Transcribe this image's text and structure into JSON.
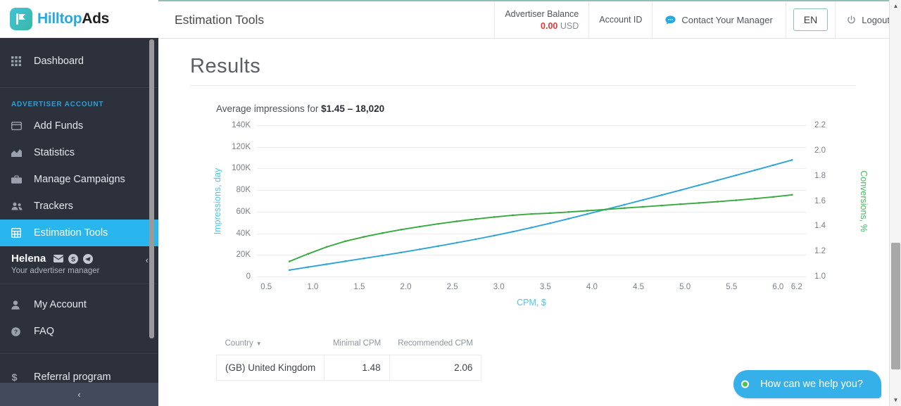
{
  "brand": {
    "name_part1": "Hilltop",
    "name_part2": "Ads",
    "logo_icon": "flag-logo-icon",
    "accent_blue": "#29a8df",
    "accent_teal": "#3ab8a8"
  },
  "sidebar": {
    "dashboard": {
      "label": "Dashboard",
      "icon": "grid-icon"
    },
    "group_label": "ADVERTISER ACCOUNT",
    "items": [
      {
        "label": "Add Funds",
        "icon": "credit-card-icon",
        "active": false
      },
      {
        "label": "Statistics",
        "icon": "chart-area-icon",
        "active": false
      },
      {
        "label": "Manage Campaigns",
        "icon": "briefcase-icon",
        "active": false
      },
      {
        "label": "Trackers",
        "icon": "users-icon",
        "active": false
      },
      {
        "label": "Estimation Tools",
        "icon": "calculator-icon",
        "active": true
      }
    ],
    "manager": {
      "name": "Helena",
      "subtitle": "Your advertiser manager",
      "icons": [
        "envelope-icon",
        "skype-icon",
        "telegram-icon"
      ],
      "collapse_icon": "chevron-left-icon"
    },
    "account_items": [
      {
        "label": "My Account",
        "icon": "user-icon"
      },
      {
        "label": "FAQ",
        "icon": "question-circle-icon"
      }
    ],
    "referral": {
      "label": "Referral program",
      "icon": "dollar-icon"
    },
    "collapse_bar_icon": "chevron-left-icon",
    "active_color": "#29b6ef"
  },
  "header": {
    "title": "Estimation Tools",
    "balance": {
      "label": "Advertiser Balance",
      "amount": "0.00",
      "currency": "USD",
      "amount_color": "#e03b3b"
    },
    "account_id": {
      "label": "Account ID"
    },
    "contact": {
      "label": "Contact Your Manager",
      "icon": "chat-bubble-icon"
    },
    "language": {
      "label": "EN"
    },
    "logout": {
      "label": "Logout",
      "icon": "power-icon"
    }
  },
  "main": {
    "page_heading": "Results",
    "chart_caption_prefix": "Average impressions for ",
    "chart_caption_value": "$1.45 – 18,020",
    "table": {
      "columns": [
        "Country",
        "Minimal CPM",
        "Recommended CPM"
      ],
      "sort_column": "Country",
      "sort_icon": "caret-down-icon",
      "rows": [
        {
          "country": "(GB) United Kingdom",
          "minimal_cpm": "1.48",
          "recommended_cpm": "2.06"
        }
      ]
    }
  },
  "chat_widget": {
    "label": "How can we help you?",
    "status_icon": "online-dot-icon",
    "bg_color": "#35b0e8"
  },
  "scrollbar": {
    "up_icon": "triangle-up-icon",
    "down_icon": "triangle-down-icon"
  },
  "chart_data": {
    "type": "line",
    "title": "",
    "xlabel": "CPM, $",
    "ylabel": "Impressions, day",
    "y2label": "Conversions, %",
    "xlim": [
      0.4,
      6.3
    ],
    "ylim": [
      0,
      140000
    ],
    "y2lim": [
      1.0,
      2.2
    ],
    "grid": true,
    "legend": "none",
    "x_ticks": [
      "0.5",
      "1.0",
      "1.5",
      "2.0",
      "2.5",
      "3.0",
      "3.5",
      "4.0",
      "4.5",
      "5.0",
      "5.5",
      "6.0",
      "6.2"
    ],
    "x_tick_values": [
      0.5,
      1.0,
      1.5,
      2.0,
      2.5,
      3.0,
      3.5,
      4.0,
      4.5,
      5.0,
      5.5,
      6.0,
      6.2
    ],
    "y_ticks": [
      "0",
      "20K",
      "40K",
      "60K",
      "80K",
      "100K",
      "120K",
      "140K"
    ],
    "y_tick_values": [
      0,
      20000,
      40000,
      60000,
      80000,
      100000,
      120000,
      140000
    ],
    "y2_ticks": [
      "1.0",
      "1.2",
      "1.4",
      "1.6",
      "1.8",
      "2.0",
      "2.2"
    ],
    "y2_tick_values": [
      1.0,
      1.2,
      1.4,
      1.6,
      1.8,
      2.0,
      2.2
    ],
    "series": [
      {
        "name": "Impressions, day",
        "color": "#2fa3d7",
        "axis": "left",
        "x": [
          0.75,
          0.95,
          1.15,
          1.35,
          1.55,
          1.75,
          1.95,
          2.15,
          2.35,
          2.55,
          2.75,
          2.95,
          3.15,
          3.35,
          3.55,
          3.75,
          3.95,
          4.15,
          4.35,
          4.55,
          4.75,
          4.95,
          5.15,
          5.35,
          5.55,
          5.75,
          5.95,
          6.15
        ],
        "y": [
          6000,
          8700,
          11400,
          14100,
          16800,
          19500,
          22300,
          25200,
          28200,
          31300,
          34500,
          37900,
          41500,
          45300,
          49300,
          53500,
          57800,
          62100,
          66500,
          70900,
          75400,
          79900,
          84500,
          89100,
          93700,
          98400,
          103100,
          107800
        ]
      },
      {
        "name": "Conversions, %",
        "color": "#37a93f",
        "axis": "right",
        "x": [
          0.75,
          0.95,
          1.15,
          1.35,
          1.55,
          1.75,
          1.95,
          2.15,
          2.35,
          2.55,
          2.75,
          2.95,
          3.15,
          3.35,
          3.55,
          3.75,
          3.95,
          4.15,
          4.35,
          4.55,
          4.75,
          4.95,
          5.15,
          5.35,
          5.55,
          5.75,
          5.95,
          6.15
        ],
        "y": [
          1.12,
          1.18,
          1.235,
          1.28,
          1.315,
          1.345,
          1.372,
          1.396,
          1.418,
          1.438,
          1.456,
          1.472,
          1.486,
          1.496,
          1.503,
          1.512,
          1.522,
          1.532,
          1.543,
          1.553,
          1.563,
          1.574,
          1.584,
          1.594,
          1.605,
          1.618,
          1.632,
          1.648
        ]
      }
    ]
  }
}
